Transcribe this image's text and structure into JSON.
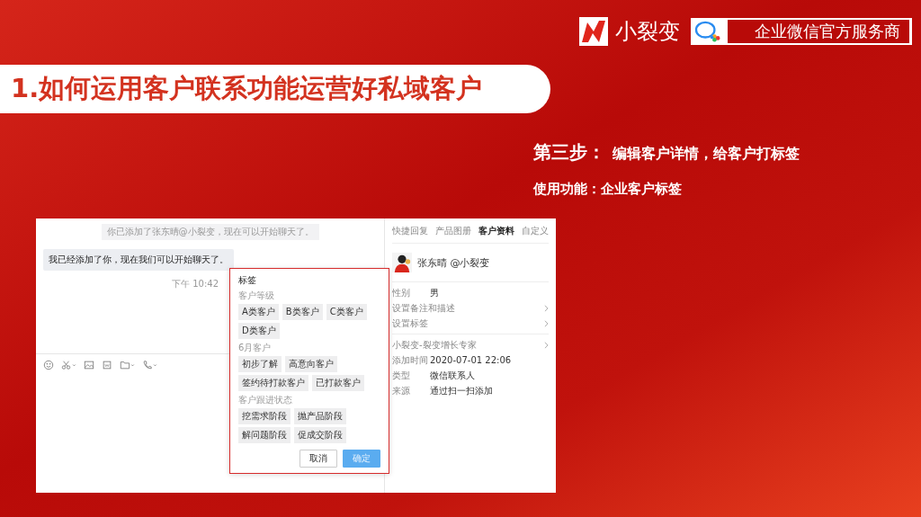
{
  "header": {
    "brand": "小裂变",
    "partner_badge": "企业微信官方服务商"
  },
  "title": "1.如何运用客户联系功能运营好私域客户",
  "step": {
    "label": "第三步：",
    "text": "编辑客户详情，给客户打标签"
  },
  "feature": {
    "label": "使用功能：",
    "text": "企业客户标签"
  },
  "chat": {
    "system_notice": "你已添加了张东晴@小裂变，现在可以开始聊天了。",
    "message": {
      "text": "我已经添加了你，现在我们可以开始聊天了。",
      "time": "下午 10:42"
    },
    "toolbar": [
      {
        "kind": "emoji",
        "dropdown": false
      },
      {
        "kind": "scissors",
        "dropdown": true
      },
      {
        "kind": "image",
        "dropdown": false
      },
      {
        "kind": "document",
        "dropdown": false
      },
      {
        "kind": "folder",
        "dropdown": true
      },
      {
        "kind": "phone",
        "dropdown": true
      }
    ]
  },
  "tag_dialog": {
    "title": "标签",
    "groups": [
      {
        "name": "客户等级",
        "tags": [
          "A类客户",
          "B类客户",
          "C类客户",
          "D类客户"
        ]
      },
      {
        "name": "6月客户",
        "tags": [
          "初步了解",
          "高意向客户",
          "签约待打款客户",
          "已打款客户"
        ]
      },
      {
        "name": "客户跟进状态",
        "tags": [
          "挖需求阶段",
          "抛产品阶段",
          "解问题阶段",
          "促成交阶段"
        ]
      }
    ],
    "buttons": [
      {
        "label": "取消",
        "kind": "secondary",
        "disabled": false
      },
      {
        "label": "确定",
        "kind": "primary",
        "disabled": true
      }
    ]
  },
  "panel": {
    "tabs": [
      {
        "label": "快捷回复",
        "selected": false
      },
      {
        "label": "产品图册",
        "selected": false
      },
      {
        "label": "客户资料",
        "selected": true
      },
      {
        "label": "自定义",
        "selected": false
      }
    ],
    "profile": {
      "name": "张东晴 @小裂变"
    },
    "sections": [
      [
        {
          "kind": "field",
          "label": "性别",
          "value": "男"
        },
        {
          "kind": "link",
          "label": "设置备注和描述"
        },
        {
          "kind": "link",
          "label": "设置标签"
        }
      ],
      [
        {
          "kind": "link",
          "label": "小裂变-裂变增长专家"
        },
        {
          "kind": "field",
          "label": "添加时间",
          "value": "2020-07-01 22:06"
        },
        {
          "kind": "field",
          "label": "类型",
          "value": "微信联系人"
        },
        {
          "kind": "field",
          "label": "来源",
          "value": "通过扫一扫添加"
        }
      ]
    ]
  }
}
